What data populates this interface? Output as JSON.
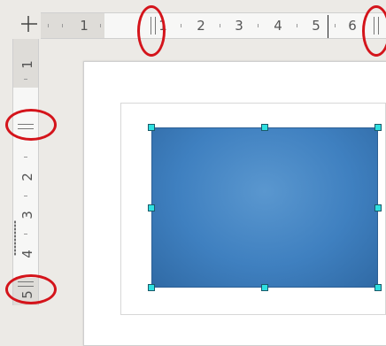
{
  "horizontal_ruler": {
    "labels": [
      "1",
      "1",
      "2",
      "3",
      "4",
      "5",
      "6"
    ]
  },
  "vertical_ruler": {
    "labels": [
      "1",
      "2",
      "3",
      "4",
      "5"
    ]
  },
  "colors": {
    "shape_fill": "#3f80c0",
    "handle": "#2ee0e0",
    "highlight": "#d4141b"
  },
  "icons": {
    "origin": "crosshair-icon"
  }
}
